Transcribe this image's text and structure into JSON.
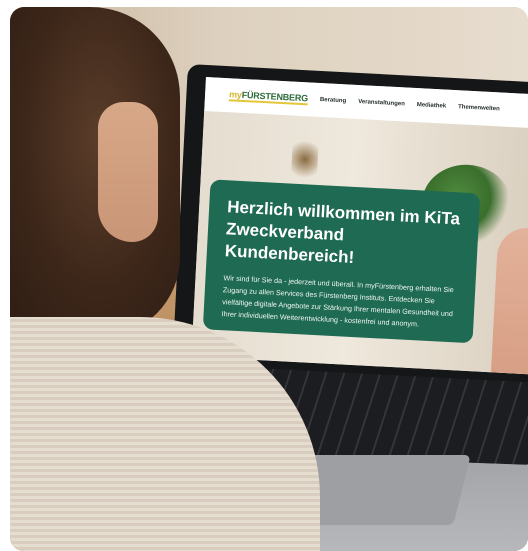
{
  "screen": {
    "logo": {
      "prefix": "my",
      "name": "FÜRSTENBERG"
    },
    "nav": [
      "Beratung",
      "Veranstaltungen",
      "Mediathek",
      "Themenwelten"
    ],
    "hero": {
      "title": "Herzlich willkommen im KiTa Zweckverband Kundenbereich!",
      "text": "Wir sind für Sie da - jederzeit und überall. In myFürstenberg erhalten Sie Zugang zu allen Services des Fürstenberg Instituts. Entdecken Sie vielfältige digitale Angebote zur Stärkung Ihrer mentalen Gesundheit und Ihrer individuellen Weiterentwicklung - kostenfrei und anonym."
    }
  },
  "colors": {
    "card": "#1f6a52",
    "logo_green": "#2d6a3a",
    "logo_yellow": "#d4b62a"
  }
}
